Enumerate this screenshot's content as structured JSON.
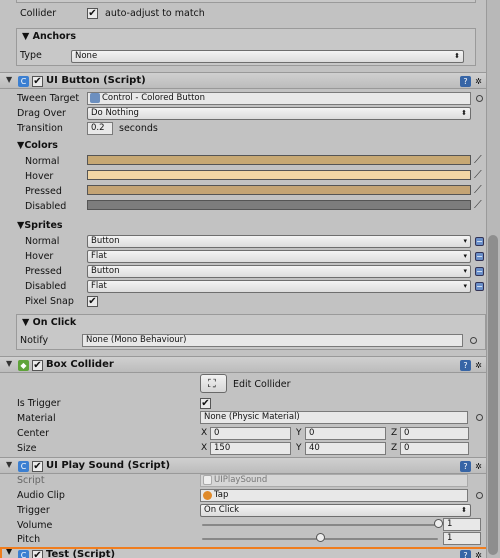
{
  "collider": {
    "label": "Collider",
    "auto_adjust_label": "auto-adjust to match",
    "checked": true
  },
  "anchors": {
    "title": "Anchors",
    "type_label": "Type",
    "type_value": "None"
  },
  "ui_button": {
    "title": "UI Button (Script)",
    "tween_target_label": "Tween Target",
    "tween_target_value": "Control - Colored Button",
    "drag_over_label": "Drag Over",
    "drag_over_value": "Do Nothing",
    "transition_label": "Transition",
    "transition_value": "0.2",
    "transition_unit": "seconds",
    "colors_title": "Colors",
    "colors": [
      {
        "label": "Normal",
        "color": "#c7a873"
      },
      {
        "label": "Hover",
        "color": "#f2d6a4"
      },
      {
        "label": "Pressed",
        "color": "#c4a474"
      },
      {
        "label": "Disabled",
        "color": "#7d7d7d"
      }
    ],
    "sprites_title": "Sprites",
    "sprites": [
      {
        "label": "Normal",
        "value": "Button"
      },
      {
        "label": "Hover",
        "value": "Flat"
      },
      {
        "label": "Pressed",
        "value": "Button"
      },
      {
        "label": "Disabled",
        "value": "Flat"
      }
    ],
    "pixel_snap_label": "Pixel Snap",
    "on_click_title": "On Click",
    "notify_label": "Notify",
    "notify_value": "None (Mono Behaviour)"
  },
  "box_collider": {
    "title": "Box Collider",
    "edit_label": "Edit Collider",
    "is_trigger_label": "Is Trigger",
    "material_label": "Material",
    "material_value": "None (Physic Material)",
    "center_label": "Center",
    "center": {
      "x": "0",
      "y": "0",
      "z": "0"
    },
    "size_label": "Size",
    "size": {
      "x": "150",
      "y": "40",
      "z": "0"
    },
    "axis": {
      "x": "X",
      "y": "Y",
      "z": "Z"
    }
  },
  "ui_play_sound": {
    "title": "UI Play Sound (Script)",
    "script_label": "Script",
    "script_value": "UIPlaySound",
    "audio_clip_label": "Audio Clip",
    "audio_clip_value": "Tap",
    "trigger_label": "Trigger",
    "trigger_value": "On Click",
    "volume_label": "Volume",
    "volume_value": "1",
    "volume_fraction": 1.0,
    "pitch_label": "Pitch",
    "pitch_value": "1",
    "pitch_fraction": 0.5
  },
  "test_script": {
    "title": "Test (Script)"
  },
  "glyphs": {
    "fold": "▼",
    "check": "✔",
    "arrow": "▾",
    "picker": "⁄",
    "minus": "−",
    "gear": "✲",
    "book": "▣"
  },
  "colors": {
    "accent_orange": "#f07d1e",
    "panel": "#c2c2c2"
  }
}
